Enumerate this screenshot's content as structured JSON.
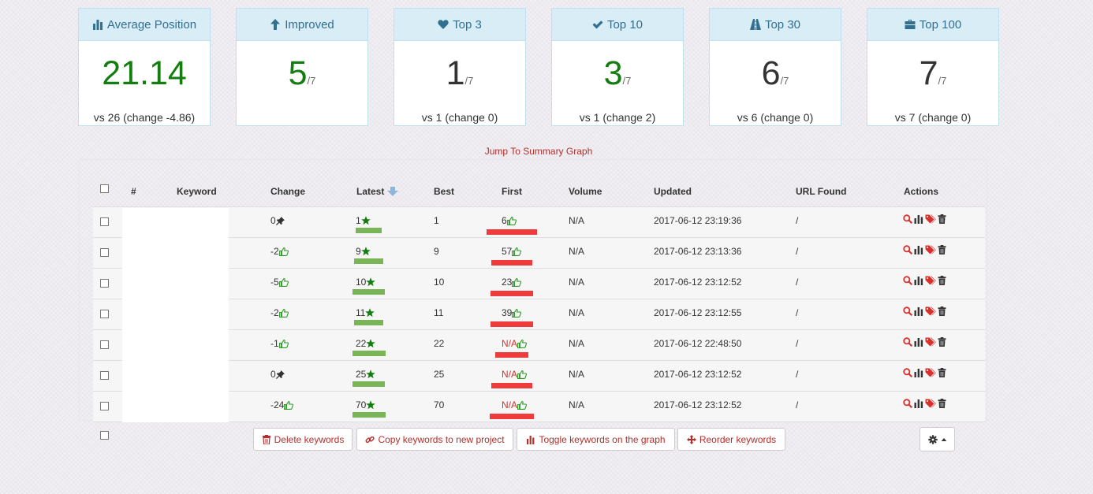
{
  "cards": [
    {
      "title": "Average Position",
      "icon": "bar-chart-icon",
      "value": "21.14",
      "suffix": "",
      "value_color": "#137d10",
      "footer": "vs 26 (change -4.86)"
    },
    {
      "title": "Improved",
      "icon": "arrow-up-icon",
      "value": "5",
      "suffix": "/7",
      "value_color": "#137d10",
      "footer": ""
    },
    {
      "title": "Top 3",
      "icon": "heart-icon",
      "value": "1",
      "suffix": "/7",
      "value_color": "#333333",
      "footer": "vs 1 (change 0)"
    },
    {
      "title": "Top 10",
      "icon": "checkmark-icon",
      "value": "3",
      "suffix": "/7",
      "value_color": "#137d10",
      "footer": "vs 1 (change 2)"
    },
    {
      "title": "Top 30",
      "icon": "road-icon",
      "value": "6",
      "suffix": "/7",
      "value_color": "#333333",
      "footer": "vs 6 (change 0)"
    },
    {
      "title": "Top 100",
      "icon": "briefcase-icon",
      "value": "7",
      "suffix": "/7",
      "value_color": "#333333",
      "footer": "vs 7 (change 0)"
    }
  ],
  "jump_link": "Jump To Summary Graph",
  "table": {
    "headers": {
      "num": "#",
      "keyword": "Keyword",
      "change": "Change",
      "latest": "Latest",
      "best": "Best",
      "first": "First",
      "volume": "Volume",
      "updated": "Updated",
      "url": "URL Found",
      "actions": "Actions"
    },
    "rows": [
      {
        "change": "0",
        "change_icon": "pin-icon",
        "latest": "1",
        "latest_bar": 0.55,
        "best": "1",
        "first": "6",
        "first_bar": 0.8,
        "first_na": false,
        "volume": "N/A",
        "updated": "2017-06-12 23:19:36",
        "url": "/"
      },
      {
        "change": "-2",
        "change_icon": "thumbs-up-icon",
        "latest": "9",
        "latest_bar": 0.62,
        "best": "9",
        "first": "57",
        "first_bar": 0.65,
        "first_na": false,
        "volume": "N/A",
        "updated": "2017-06-12 23:13:36",
        "url": "/"
      },
      {
        "change": "-5",
        "change_icon": "thumbs-up-icon",
        "latest": "10",
        "latest_bar": 0.68,
        "best": "10",
        "first": "23",
        "first_bar": 0.68,
        "first_na": false,
        "volume": "N/A",
        "updated": "2017-06-12 23:12:52",
        "url": "/"
      },
      {
        "change": "-2",
        "change_icon": "thumbs-up-icon",
        "latest": "11",
        "latest_bar": 0.62,
        "best": "11",
        "first": "39",
        "first_bar": 0.68,
        "first_na": false,
        "volume": "N/A",
        "updated": "2017-06-12 23:12:55",
        "url": "/"
      },
      {
        "change": "-1",
        "change_icon": "thumbs-up-icon",
        "latest": "22",
        "latest_bar": 0.7,
        "best": "22",
        "first": "N/A",
        "first_bar": 0.52,
        "first_na": true,
        "volume": "N/A",
        "updated": "2017-06-12 22:48:50",
        "url": "/"
      },
      {
        "change": "0",
        "change_icon": "pin-icon",
        "latest": "25",
        "latest_bar": 0.68,
        "best": "25",
        "first": "N/A",
        "first_bar": 0.65,
        "first_na": true,
        "volume": "N/A",
        "updated": "2017-06-12 23:12:52",
        "url": "/"
      },
      {
        "change": "-24",
        "change_icon": "thumbs-up-icon",
        "latest": "70",
        "latest_bar": 0.7,
        "best": "70",
        "first": "N/A",
        "first_bar": 0.7,
        "first_na": true,
        "volume": "N/A",
        "updated": "2017-06-12 23:12:52",
        "url": "/"
      }
    ]
  },
  "buttons": {
    "delete": "Delete keywords",
    "copy": "Copy keywords to new project",
    "toggle": "Toggle keywords on the graph",
    "reorder": "Reorder keywords"
  },
  "colors": {
    "green": "#137d10",
    "accent_red": "#b32f2b",
    "bar_green": "#79b557",
    "bar_red": "#ef3b3b"
  }
}
